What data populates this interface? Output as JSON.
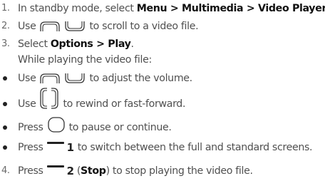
{
  "steps": [
    {
      "number": "1.",
      "text_a": "In standby mode, select ",
      "menu": "Menu",
      "sep1": " > ",
      "multimedia": "Multimedia",
      "sep2": " > ",
      "video_player": "Video Player",
      "end": "."
    },
    {
      "number": "2.",
      "text_a": "Use",
      "text_b": "to scroll to a video file."
    },
    {
      "number": "3.",
      "text_a": "Select ",
      "options": "Options",
      "sep": " > ",
      "play": "Play",
      "end": "."
    },
    {
      "number": "4.",
      "text_a": "Press",
      "key_digit": "2",
      "paren_open": " (",
      "stop": "Stop",
      "paren_close": ")",
      "text_b": " to stop playing the video file."
    }
  ],
  "while_playing": "While playing the video file:",
  "bullets": [
    {
      "text_a": "Use",
      "text_b": "to adjust the volume."
    },
    {
      "text_a": "Use",
      "text_b": "to rewind or fast-forward."
    },
    {
      "text_a": "Press",
      "text_b": "to pause or continue."
    },
    {
      "text_a": "Press",
      "key_digit": "1",
      "text_b": "to switch between the full and standard screens."
    }
  ],
  "icons": {
    "up_key": "navigation-up-key-icon",
    "down_key": "navigation-down-key-icon",
    "left_right_keys": "navigation-left-right-keys-icon",
    "center_key": "center-confirm-key-icon",
    "left_soft_key": "left-soft-key-icon",
    "right_soft_key": "right-soft-key-icon"
  },
  "colors": {
    "body_text": "#505050",
    "bold_text": "#111111",
    "key_outline": "#333333"
  }
}
